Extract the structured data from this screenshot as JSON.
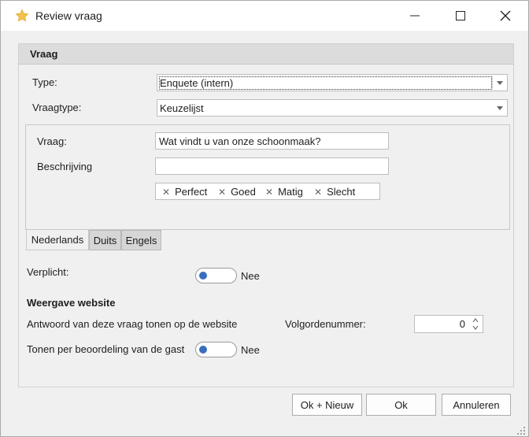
{
  "window": {
    "title": "Review vraag",
    "icon": "star-icon",
    "controls": [
      "minimize-icon",
      "maximize-icon",
      "close-icon"
    ]
  },
  "panel": {
    "header": "Vraag",
    "type_label": "Type:",
    "type_value": "Enquete (intern)",
    "vraagtype_label": "Vraagtype:",
    "vraagtype_value": "Keuzelijst"
  },
  "question": {
    "vraag_label": "Vraag:",
    "vraag_value": "Wat vindt u van onze schoonmaak?",
    "beschrijving_label": "Beschrijving",
    "beschrijving_value": "",
    "options": [
      "Perfect",
      "Goed",
      "Matig",
      "Slecht"
    ],
    "remove_icon": "x-icon"
  },
  "tabs": [
    {
      "label": "Nederlands",
      "active": true
    },
    {
      "label": "Duits",
      "active": false
    },
    {
      "label": "Engels",
      "active": false
    }
  ],
  "verplicht": {
    "label": "Verplicht:",
    "value": "Nee",
    "on": false
  },
  "website": {
    "title": "Weergave website",
    "show_label": "Antwoord van deze vraag tonen op de website",
    "order_label": "Volgordenummer:",
    "order_value": "0",
    "per_beoordeling_label": "Tonen per beoordeling van de gast",
    "per_beoordeling_value": "Nee",
    "per_beoordeling_on": false
  },
  "buttons": {
    "ok_new": "Ok + Nieuw",
    "ok": "Ok",
    "cancel": "Annuleren"
  },
  "colors": {
    "accent": "#3a6fbf",
    "star": "#f2c24a"
  }
}
